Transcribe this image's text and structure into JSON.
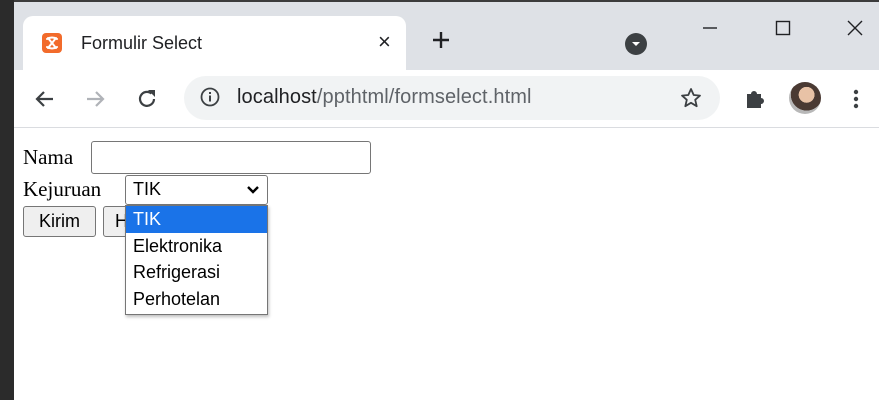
{
  "browser": {
    "tab_title": "Formulir Select",
    "tab_close": "×",
    "url_host": "localhost",
    "url_path": "/ppthtml/formselect.html"
  },
  "form": {
    "nama_label": "Nama",
    "nama_value": "",
    "kejuruan_label": "Kejuruan",
    "kejuruan_selected": "TIK",
    "options": [
      "TIK",
      "Elektronika",
      "Refrigerasi",
      "Perhotelan"
    ],
    "submit_label": "Kirim",
    "reset_label_visible": "H"
  },
  "colors": {
    "accent": "#1a73e8",
    "favicon": "#f26b2b"
  }
}
